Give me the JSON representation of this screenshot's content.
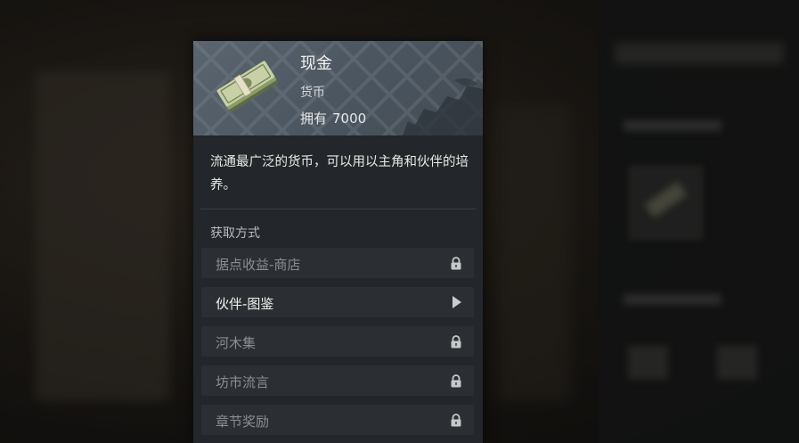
{
  "item": {
    "name": "现金",
    "type": "货币",
    "own_label": "拥有",
    "own_count": "7000",
    "icon": "cash-stack-icon",
    "description": "流通最广泛的货币，可以用以主角和伙伴的培养。"
  },
  "sources": {
    "title": "获取方式",
    "items": [
      {
        "label": "据点收益-商店",
        "locked": true
      },
      {
        "label": "伙伴-图鉴",
        "locked": false
      },
      {
        "label": "河木集",
        "locked": true
      },
      {
        "label": "坊市流言",
        "locked": true
      },
      {
        "label": "章节奖励",
        "locked": true
      }
    ]
  },
  "colors": {
    "header_bg": "#4b555f",
    "panel_bg": "#23262a",
    "row_bg": "#2b2f33",
    "active_text": "#f2f2ef",
    "locked_text": "#8a8e92"
  }
}
